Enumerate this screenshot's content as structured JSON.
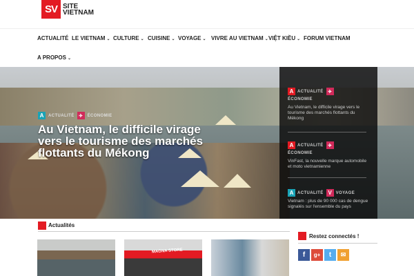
{
  "header": {
    "logo_mark": "SV",
    "logo_line1": "SITE",
    "logo_line2": "VIETNAM"
  },
  "nav": {
    "items": [
      {
        "label": "ACTUALITÉ",
        "has_submenu": false
      },
      {
        "label": "LE VIETNAM",
        "has_submenu": true
      },
      {
        "label": "CULTURE",
        "has_submenu": true
      },
      {
        "label": "CUISINE",
        "has_submenu": true
      },
      {
        "label": "VOYAGE",
        "has_submenu": true
      },
      {
        "label": "VIVRE AU VIETNAM",
        "has_submenu": true
      },
      {
        "label": "VIỆT KIỀU",
        "has_submenu": true
      },
      {
        "label": "FORUM VIETNAM",
        "has_submenu": false
      },
      {
        "label": "A PROPOS",
        "has_submenu": true
      }
    ],
    "chevron": "⌄"
  },
  "hero": {
    "badge_a": "A",
    "badge_c": "✈",
    "cat1": "ACTUALITÉ",
    "cat2": "ÉCONOMIE",
    "title": "Au Vietnam, le difficile virage vers le tourisme des marchés flottants du Mékong"
  },
  "sidebar": {
    "stories": [
      {
        "badge1": "A",
        "cat1": "ACTUALITÉ",
        "badge2": "✈",
        "cat2": "ÉCONOMIE",
        "text": "Au Vietnam, le difficile virage vers le tourisme des marchés flottants du Mékong"
      },
      {
        "badge1": "A",
        "cat1": "ACTUALITÉ",
        "badge2": "✈",
        "cat2": "ÉCONOMIE",
        "text": "VinFast, la nouvelle marque automobile et moto vietnamienne"
      },
      {
        "badge1": "A",
        "cat1": "ACTUALITÉ",
        "badge2": "V",
        "cat2": "VOYAGE",
        "text": "Vietnam : plus de 90 000 cas de dengue signalés sur l'ensemble du pays"
      }
    ]
  },
  "news": {
    "title": "Actualités",
    "thumb2_brand": "MAGNA STORE"
  },
  "social": {
    "title": "Restez connectés !",
    "icons": [
      {
        "name": "facebook-icon",
        "glyph": "f"
      },
      {
        "name": "google-plus-icon",
        "glyph": "g+"
      },
      {
        "name": "twitter-icon",
        "glyph": "t"
      },
      {
        "name": "email-icon",
        "glyph": "✉"
      }
    ]
  },
  "colors": {
    "brand_red": "#e31b23",
    "teal": "#1aa3b6",
    "pink": "#d12a5a"
  }
}
